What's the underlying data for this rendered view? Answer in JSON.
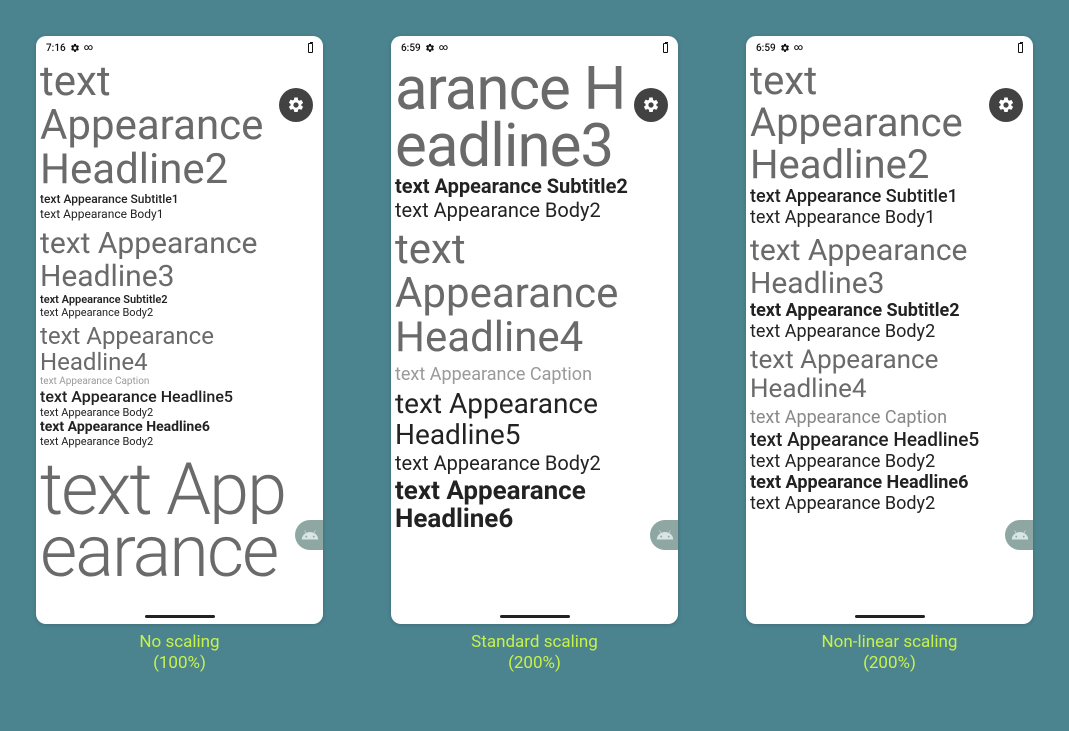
{
  "background_hex": "#4b838f",
  "caption_color_hex": "#c7f24a",
  "panels": {
    "a": {
      "status_time": "7:16",
      "status_extra": "∞",
      "lines": [
        "text",
        "Appearance",
        "Headline2",
        "text Appearance Subtitle1",
        "text Appearance Body1",
        "text Appearance",
        "Headline3",
        "text Appearance Subtitle2",
        "text Appearance Body2",
        "text Appearance",
        "Headline4",
        "text Appearance Caption",
        "text Appearance Headline5",
        "text Appearance Body2",
        "text Appearance Headline6",
        "text Appearance Body2",
        "text App",
        "earance"
      ],
      "caption_line1": "No scaling",
      "caption_line2": "(100%)"
    },
    "b": {
      "status_time": "6:59",
      "status_extra": "∞",
      "lines": [
        "arance H",
        "eadline3",
        "text Appearance Subtitle2",
        "text Appearance Body2",
        "text",
        "Appearance",
        "Headline4",
        "text Appearance Caption",
        "text Appearance",
        "Headline5",
        "text Appearance Body2",
        "text Appearance",
        "Headline6"
      ],
      "caption_line1": "Standard scaling",
      "caption_line2": "(200%)"
    },
    "c": {
      "status_time": "6:59",
      "status_extra": "∞",
      "lines": [
        "text",
        "Appearance",
        "Headline2",
        "text Appearance Subtitle1",
        "text Appearance Body1",
        "text Appearance",
        "Headline3",
        "text Appearance Subtitle2",
        "text Appearance Body2",
        "text Appearance",
        "Headline4",
        "text Appearance Caption",
        "text Appearance Headline5",
        "text Appearance Body2",
        "text Appearance Headline6",
        "text Appearance Body2"
      ],
      "caption_line1": "Non-linear scaling",
      "caption_line2": "(200%)"
    }
  }
}
